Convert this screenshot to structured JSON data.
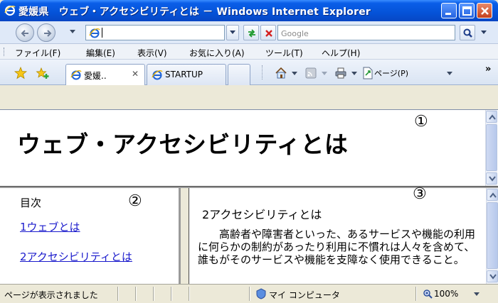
{
  "window": {
    "title": "愛媛県　ウェブ・アクセシビリティとは － Windows Internet Explorer"
  },
  "navbar": {
    "address_value": "",
    "search_placeholder": "Google"
  },
  "menu": [
    {
      "label": "ファイル(F)"
    },
    {
      "label": "編集(E)"
    },
    {
      "label": "表示(V)"
    },
    {
      "label": "お気に入り(A)"
    },
    {
      "label": "ツール(T)"
    },
    {
      "label": "ヘルプ(H)"
    }
  ],
  "tabs": [
    {
      "label": "愛媛..",
      "active": true
    },
    {
      "label": "STARTUP",
      "active": false
    }
  ],
  "toolbar": {
    "page_label": "ページ(P)",
    "overflow": "»"
  },
  "page": {
    "heading": "ウェブ・アクセシビリティとは",
    "marker_top": "①",
    "marker_left": "②",
    "marker_right": "③",
    "toc": {
      "title": "目次",
      "links": [
        "1ウェブとは",
        "2アクセシビリティとは"
      ]
    },
    "section": {
      "title": "2アクセシビリティとは",
      "body": "高齢者や障害者といった、あるサービスや機能の利用に何らかの制約があったり利用に不慣れは人々を含めて、誰もがそのサービスや機能を支障なく使用できること。"
    }
  },
  "status": {
    "message": "ページが表示されました",
    "zone": "マイ コンピュータ",
    "zoom": "100%"
  },
  "colors": {
    "titlebar": "#0553d8",
    "link": "#1a1acc"
  }
}
